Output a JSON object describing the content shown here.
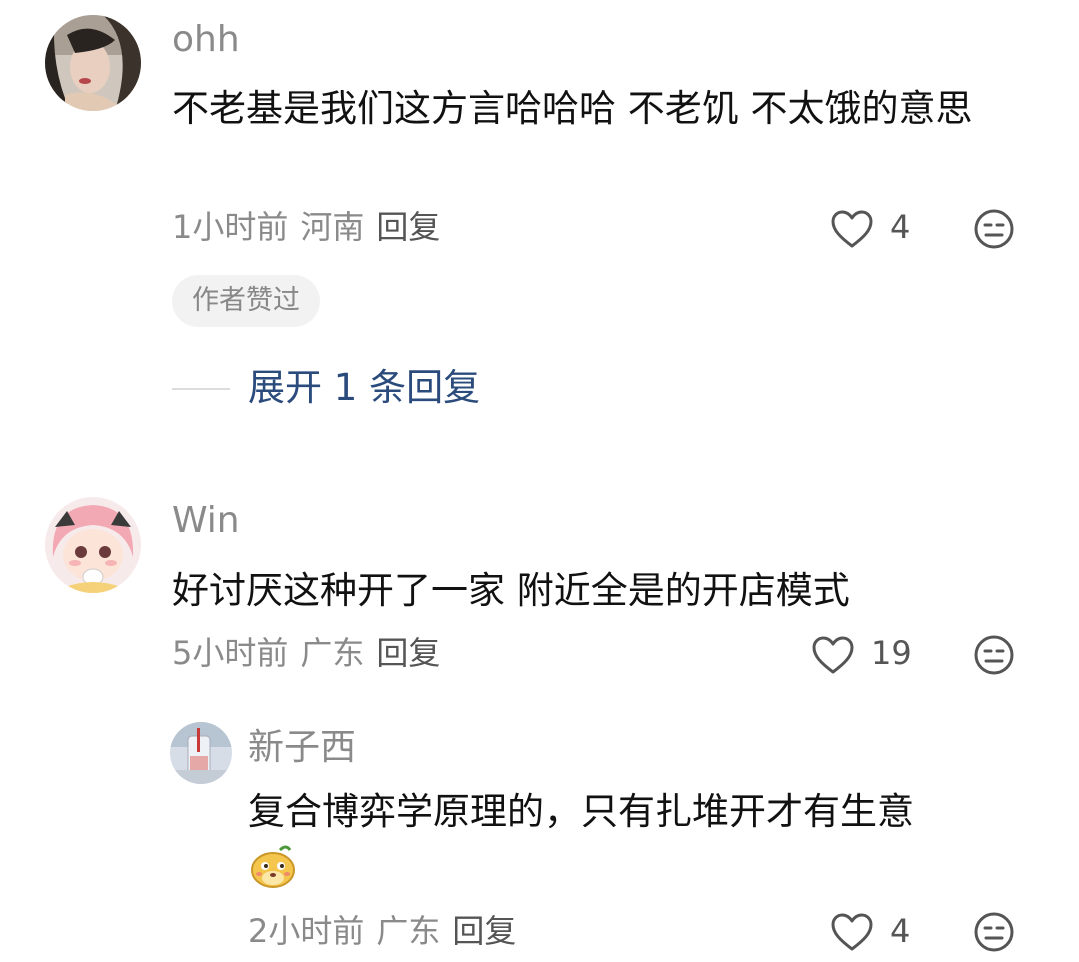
{
  "comments": [
    {
      "username": "ohh",
      "text": "不老基是我们这方言哈哈哈 不老饥 不太饿的意思",
      "time": "1小时前",
      "location": "河南",
      "reply_label": "回复",
      "likes": "4",
      "badge": "作者赞过",
      "expand_label": "展开 1 条回复"
    },
    {
      "username": "Win",
      "text": "好讨厌这种开了一家 附近全是的开店模式",
      "time": "5小时前",
      "location": "广东",
      "reply_label": "回复",
      "likes": "19"
    }
  ],
  "reply": {
    "username": "新子西",
    "text": "复合博弈学原理的，只有扎堆开才有生意",
    "emoji": "doge-dog-emoji",
    "time": "2小时前",
    "location": "广东",
    "reply_label": "回复",
    "likes": "4"
  },
  "icons": {
    "like": "heart-outline-icon",
    "dislike": "meh-face-icon"
  },
  "colors": {
    "link": "#2a4b7c",
    "meta": "#8a8a8a",
    "badge_bg": "#f2f2f2"
  }
}
